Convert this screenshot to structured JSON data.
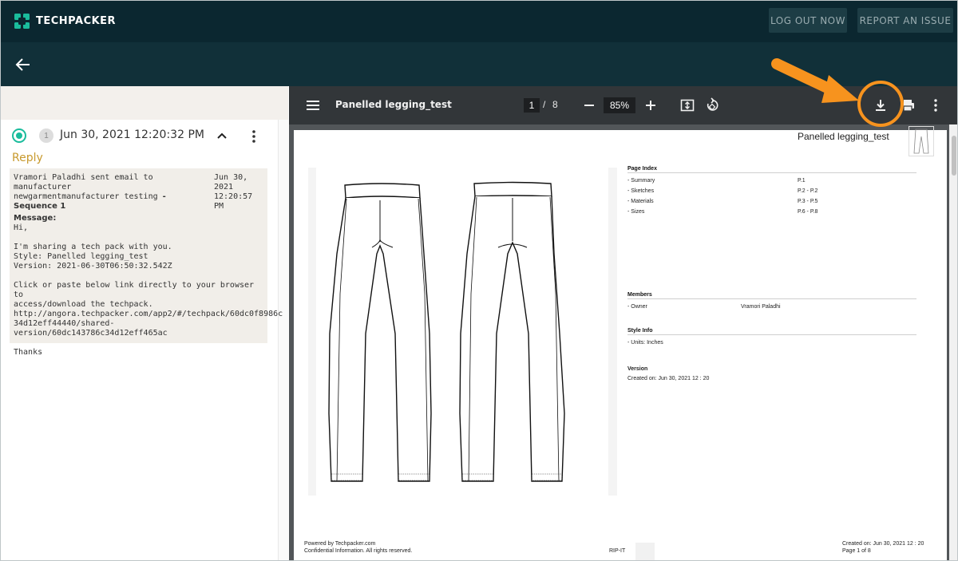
{
  "app": {
    "logo_text": "TECHPACKER",
    "logout_label": "LOG OUT NOW",
    "report_label": "REPORT AN ISSUE"
  },
  "thread": {
    "sequence_number": "1",
    "datetime": "Jun 30, 2021 12:20:32 PM",
    "reply_label": "Reply",
    "header_line1": "Vramori Paladhi sent email to manufacturer",
    "header_line2": "newgarmentmanufacturer testing",
    "header_bold": "- Sequence 1",
    "header_date": "Jun 30,\n2021\n12:20:57 PM",
    "message_label": "Message:",
    "message_body": "Hi,\n\nI'm sharing a tech pack with you.\nStyle: Panelled legging_test\nVersion: 2021-06-30T06:50:32.542Z\n\nClick or paste below link directly to your browser to\naccess/download the techpack.\nhttp://angora.techpacker.com/app2/#/techpack/60dc0f8986c\n34d12eff44440/shared-version/60dc143786c34d12eff465ac\n\nThanks"
  },
  "viewer": {
    "doc_title": "Panelled legging_test",
    "current_page": "1",
    "separator": "/",
    "total_pages": "8",
    "zoom": "85%",
    "icons": [
      "menu-icon",
      "zoom-out-icon",
      "zoom-in-icon",
      "fit-page-icon",
      "rotate-icon",
      "download-icon",
      "print-icon",
      "more-icon"
    ]
  },
  "pdf_page": {
    "name": "Panelled legging_test",
    "page_index_title": "Page Index",
    "page_index": [
      {
        "label": "- Summary",
        "pages": "P.1"
      },
      {
        "label": "- Sketches",
        "pages": "P.2 - P.2"
      },
      {
        "label": "- Materials",
        "pages": "P.3 - P.5"
      },
      {
        "label": "- Sizes",
        "pages": "P.6 - P.8"
      }
    ],
    "members_title": "Members",
    "member_role": "- Owner",
    "member_name": "Vramori Paladhi",
    "style_info_title": "Style Info",
    "units": "- Units: Inches",
    "version_title": "Version",
    "created_on": "Created on: Jun 30, 2021 12 : 20",
    "footer_powered": "Powered by Techpacker.com",
    "footer_confidential": "Confidential Information. All rights reserved.",
    "footer_center": "RIP-IT",
    "footer_created": "Created on: Jun 30, 2021 12 : 20",
    "footer_page": "Page 1 of 8"
  },
  "colors": {
    "topbar": "#0b2730",
    "subbar": "#113039",
    "accent_teal": "#1abc9c",
    "reply_gold": "#c89a2e",
    "callout_orange": "#f7931e"
  }
}
